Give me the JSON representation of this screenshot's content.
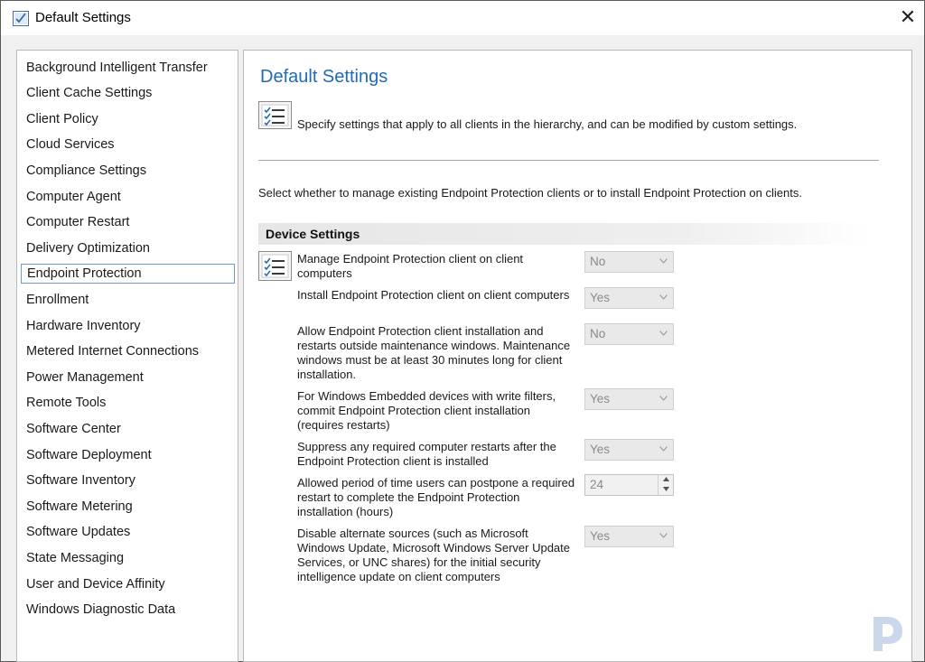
{
  "window": {
    "title": "Default Settings",
    "close_glyph": "✕"
  },
  "nav": {
    "items": [
      "Background Intelligent Transfer",
      "Client Cache Settings",
      "Client Policy",
      "Cloud Services",
      "Compliance Settings",
      "Computer Agent",
      "Computer Restart",
      "Delivery Optimization",
      "Endpoint Protection",
      "Enrollment",
      "Hardware Inventory",
      "Metered Internet Connections",
      "Power Management",
      "Remote Tools",
      "Software Center",
      "Software Deployment",
      "Software Inventory",
      "Software Metering",
      "Software Updates",
      "State Messaging",
      "User and Device Affinity",
      "Windows Diagnostic Data"
    ],
    "selected_index": 8
  },
  "content": {
    "title": "Default Settings",
    "description": "Specify settings that apply to all clients in the hierarchy, and can be modified by custom settings.",
    "instruction": "Select whether to manage existing Endpoint Protection clients or to install Endpoint Protection on clients.",
    "group_header": "Device Settings",
    "settings": [
      {
        "label": "Manage Endpoint Protection client on client computers",
        "value": "No",
        "control": "combo"
      },
      {
        "label": "Install Endpoint Protection client on client computers",
        "value": "Yes",
        "control": "combo"
      },
      {
        "label": "Allow Endpoint Protection client installation and restarts outside maintenance windows. Maintenance windows must be at least 30 minutes long for client installation.",
        "value": "No",
        "control": "combo"
      },
      {
        "label": "For Windows Embedded devices with write filters, commit Endpoint Protection client installation (requires restarts)",
        "value": "Yes",
        "control": "combo"
      },
      {
        "label": "Suppress any required computer restarts after the Endpoint Protection client is installed",
        "value": "Yes",
        "control": "combo"
      },
      {
        "label": "Allowed period of time users can postpone a required restart to complete the Endpoint Protection installation (hours)",
        "value": "24",
        "control": "spin"
      },
      {
        "label": "Disable alternate sources (such as Microsoft Windows Update, Microsoft Windows Server Update Services, or UNC shares) for the initial security intelligence update on client computers",
        "value": "Yes",
        "control": "combo"
      }
    ]
  },
  "icons": {
    "title_icon": "settings-checklist-icon",
    "header_icon": "checklist-icon",
    "row_icon": "checklist-icon",
    "combo_arrow": "chevron-down-icon",
    "watermark": "brand-logo-icon"
  },
  "colors": {
    "title_blue": "#1f6bb7",
    "selection_border": "#6b9bd8",
    "disabled_text": "#8a8a8a",
    "group_header_bg": "#e6e6e6"
  }
}
